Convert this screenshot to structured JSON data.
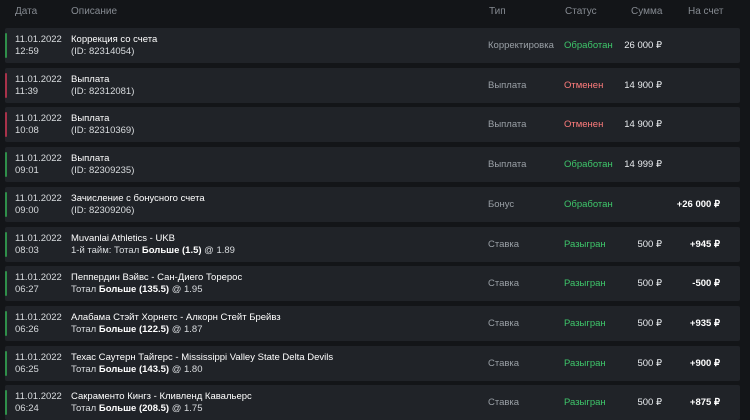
{
  "colors": {
    "processed": "#3ec66a",
    "cancelled": "#ff7c7c",
    "played": "#3ec66a",
    "bar_green": "#2f8f4a",
    "bar_red": "#a8324a"
  },
  "header": {
    "date": "Дата",
    "description": "Описание",
    "type": "Тип",
    "status": "Статус",
    "amount": "Сумма",
    "balance": "На счет"
  },
  "rows": [
    {
      "date": "11.01.2022",
      "time": "12:59",
      "title": "Коррекция со счета",
      "detail_prefix": "(ID: 82314054)",
      "detail_bold": "",
      "detail_suffix": "",
      "type": "Корректировка",
      "status": "Обработан",
      "status_kind": "processed",
      "amount": "26 000 ₽",
      "balance": ""
    },
    {
      "date": "11.01.2022",
      "time": "11:39",
      "title": "Выплата",
      "detail_prefix": "(ID: 82312081)",
      "detail_bold": "",
      "detail_suffix": "",
      "type": "Выплата",
      "status": "Отменен",
      "status_kind": "cancelled",
      "amount": "14 900 ₽",
      "balance": ""
    },
    {
      "date": "11.01.2022",
      "time": "10:08",
      "title": "Выплата",
      "detail_prefix": "(ID: 82310369)",
      "detail_bold": "",
      "detail_suffix": "",
      "type": "Выплата",
      "status": "Отменен",
      "status_kind": "cancelled",
      "amount": "14 900 ₽",
      "balance": ""
    },
    {
      "date": "11.01.2022",
      "time": "09:01",
      "title": "Выплата",
      "detail_prefix": "(ID: 82309235)",
      "detail_bold": "",
      "detail_suffix": "",
      "type": "Выплата",
      "status": "Обработан",
      "status_kind": "processed",
      "amount": "14 999 ₽",
      "balance": ""
    },
    {
      "date": "11.01.2022",
      "time": "09:00",
      "title": "Зачисление с бонусного счета",
      "detail_prefix": "(ID: 82309206)",
      "detail_bold": "",
      "detail_suffix": "",
      "type": "Бонус",
      "status": "Обработан",
      "status_kind": "processed",
      "amount": "",
      "balance": "+26 000 ₽"
    },
    {
      "date": "11.01.2022",
      "time": "08:03",
      "title": "Muvanlai Athletics - UKB",
      "detail_prefix": "1-й тайм: Тотал ",
      "detail_bold": "Больше (1.5)",
      "detail_suffix": " @ 1.89",
      "type": "Ставка",
      "status": "Разыгран",
      "status_kind": "played",
      "amount": "500 ₽",
      "balance": "+945 ₽"
    },
    {
      "date": "11.01.2022",
      "time": "06:27",
      "title": "Пеппердин Вэйвс - Сан-Диего Торерос",
      "detail_prefix": "Тотал ",
      "detail_bold": "Больше (135.5)",
      "detail_suffix": " @ 1.95",
      "type": "Ставка",
      "status": "Разыгран",
      "status_kind": "played",
      "amount": "500 ₽",
      "balance": "-500 ₽"
    },
    {
      "date": "11.01.2022",
      "time": "06:26",
      "title": "Алабама Стэйт Хорнетс - Алкорн Стейт Брейвз",
      "detail_prefix": "Тотал ",
      "detail_bold": "Больше (122.5)",
      "detail_suffix": " @ 1.87",
      "type": "Ставка",
      "status": "Разыгран",
      "status_kind": "played",
      "amount": "500 ₽",
      "balance": "+935 ₽"
    },
    {
      "date": "11.01.2022",
      "time": "06:25",
      "title": "Техас Саутерн Тайгерс - Mississippi Valley State Delta Devils",
      "detail_prefix": "Тотал ",
      "detail_bold": "Больше (143.5)",
      "detail_suffix": " @ 1.80",
      "type": "Ставка",
      "status": "Разыгран",
      "status_kind": "played",
      "amount": "500 ₽",
      "balance": "+900 ₽"
    },
    {
      "date": "11.01.2022",
      "time": "06:24",
      "title": "Сакраменто Кингз - Кливленд Кавальерс",
      "detail_prefix": "Тотал ",
      "detail_bold": "Больше (208.5)",
      "detail_suffix": " @ 1.75",
      "type": "Ставка",
      "status": "Разыгран",
      "status_kind": "played",
      "amount": "500 ₽",
      "balance": "+875 ₽"
    }
  ]
}
